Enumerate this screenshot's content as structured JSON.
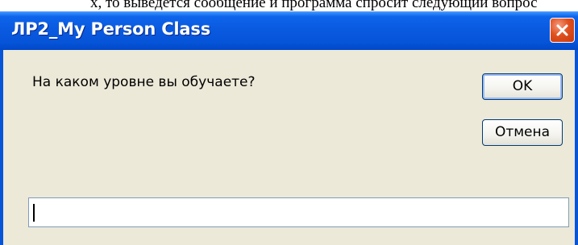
{
  "top_strip": {
    "text": "х, то выведется сообщение и программа спросит следующий вопрос"
  },
  "dialog": {
    "title": "ЛР2_My Person Class",
    "prompt": "На каком уровне вы обучаете?",
    "ok_label": "OK",
    "cancel_label": "Отмена",
    "input_value": ""
  },
  "icons": {
    "close": "close-icon"
  },
  "colors": {
    "titlebar": "#0654d8",
    "close": "#e0501f",
    "body": "#ece9d8"
  }
}
